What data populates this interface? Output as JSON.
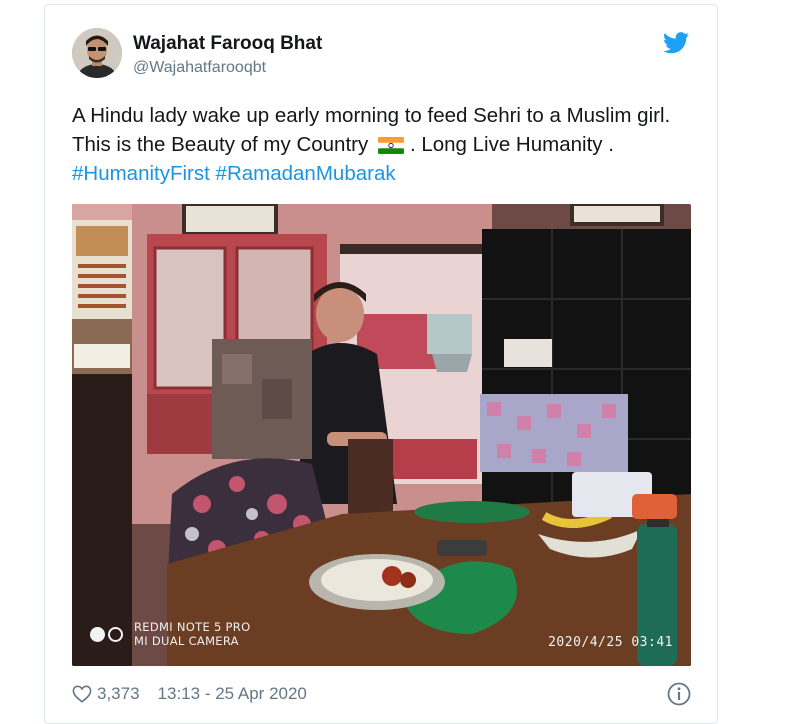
{
  "tweet": {
    "author_name": "Wajahat Farooq Bhat",
    "author_handle": "@Wajahatfarooqbt",
    "text_part1": "A Hindu lady wake up early morning to feed Sehri to a Muslim girl. This is the Beauty of my Country",
    "text_part2": ".  Long Live Humanity .",
    "hashtags": [
      "#HumanityFirst",
      "#RamadanMubarak"
    ],
    "flag_icon": "india-flag-emoji"
  },
  "photo": {
    "watermark_line1": "REDMI NOTE 5 PRO",
    "watermark_line2": "MI DUAL CAMERA",
    "timestamp": "2020/4/25  03:41"
  },
  "footer": {
    "likes": "3,373",
    "time_date": "13:13 - 25 Apr 2020"
  },
  "colors": {
    "twitter_blue": "#1da1f2",
    "hashtag_blue": "#1b95e0",
    "muted_gray": "#657786"
  },
  "icons": [
    "twitter-bird-icon",
    "heart-icon",
    "info-icon"
  ]
}
